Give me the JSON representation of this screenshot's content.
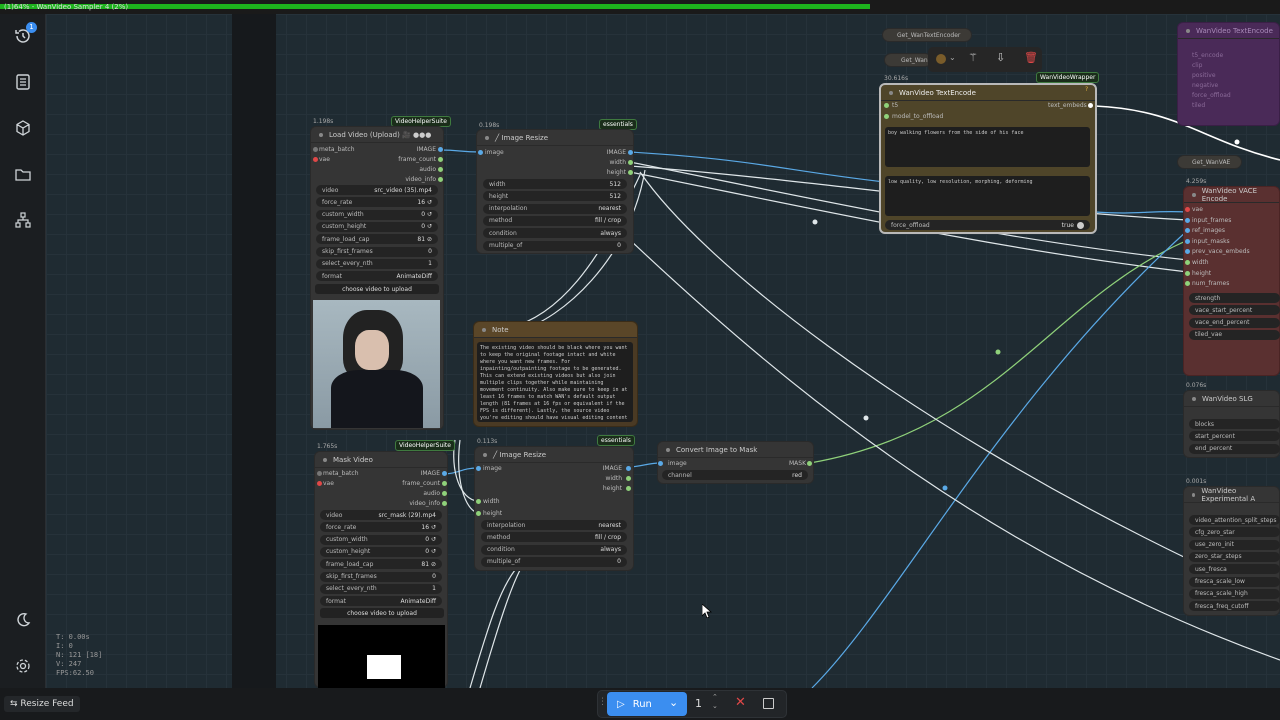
{
  "topbar": {
    "title": "(1)64% - WanVideo Sampler 4 (2%)",
    "progress_percent": 68
  },
  "sidebar": {
    "queue_badge": "1",
    "icons": [
      "history-icon",
      "document-icon",
      "cube-icon",
      "folder-icon",
      "workflow-icon",
      "moon-icon",
      "settings-icon"
    ]
  },
  "stats": {
    "t": "T: 0.00s",
    "i": "I: 0",
    "n": "N: 121 [18]",
    "v": "V: 247",
    "fps": "FPS:62.50"
  },
  "bottom": {
    "resize_feed": "⇆ Resize Feed",
    "run_label": "Run",
    "run_count": "1"
  },
  "load_video": {
    "timing": "1.198s",
    "badge": "VideoHelperSuite",
    "title": "Load Video (Upload) 🎥 ●●●",
    "inputs": [
      "meta_batch",
      "vae"
    ],
    "outputs": [
      "IMAGE",
      "frame_count",
      "audio",
      "video_info"
    ],
    "widgets": [
      {
        "label": "video",
        "value": "src_video (35).mp4"
      },
      {
        "label": "force_rate",
        "value": "16 ↺"
      },
      {
        "label": "custom_width",
        "value": "0 ↺"
      },
      {
        "label": "custom_height",
        "value": "0 ↺"
      },
      {
        "label": "frame_load_cap",
        "value": "81 ⊘"
      },
      {
        "label": "skip_first_frames",
        "value": "0"
      },
      {
        "label": "select_every_nth",
        "value": "1"
      },
      {
        "label": "format",
        "value": "AnimateDiff"
      }
    ],
    "upload_label": "choose video to upload"
  },
  "mask_video": {
    "timing": "1.765s",
    "badge": "VideoHelperSuite",
    "title": "Mask Video",
    "inputs": [
      "meta_batch",
      "vae"
    ],
    "outputs": [
      "IMAGE",
      "frame_count",
      "audio",
      "video_info"
    ],
    "widgets": [
      {
        "label": "video",
        "value": "src_mask (29).mp4"
      },
      {
        "label": "force_rate",
        "value": "16 ↺"
      },
      {
        "label": "custom_width",
        "value": "0 ↺"
      },
      {
        "label": "custom_height",
        "value": "0 ↺"
      },
      {
        "label": "frame_load_cap",
        "value": "81 ⊘"
      },
      {
        "label": "skip_first_frames",
        "value": "0"
      },
      {
        "label": "select_every_nth",
        "value": "1"
      },
      {
        "label": "format",
        "value": "AnimateDiff"
      }
    ],
    "upload_label": "choose video to upload"
  },
  "resize1": {
    "timing": "0.198s",
    "badge": "essentials",
    "title": "╱ Image Resize",
    "input": "image",
    "outputs": [
      "IMAGE",
      "width",
      "height"
    ],
    "widgets": [
      {
        "label": "width",
        "value": "512"
      },
      {
        "label": "height",
        "value": "512"
      },
      {
        "label": "interpolation",
        "value": "nearest"
      },
      {
        "label": "method",
        "value": "fill / crop"
      },
      {
        "label": "condition",
        "value": "always"
      },
      {
        "label": "multiple_of",
        "value": "0"
      }
    ]
  },
  "resize2": {
    "timing": "0.113s",
    "badge": "essentials",
    "title": "╱ Image Resize",
    "inputs": [
      "image",
      "width",
      "height"
    ],
    "outputs": [
      "IMAGE",
      "width",
      "height"
    ],
    "widgets": [
      {
        "label": "interpolation",
        "value": "nearest"
      },
      {
        "label": "method",
        "value": "fill / crop"
      },
      {
        "label": "condition",
        "value": "always"
      },
      {
        "label": "multiple_of",
        "value": "0"
      }
    ]
  },
  "note": {
    "title": "Note",
    "text": "The existing video should be black where you want to keep the original footage intact and white where you want new frames. For inpainting/outpainting footage to be generated. This can extend existing videos but also join multiple clips together while maintaining movement continuity. Also make sure to keep in at least 16 frames to match WAN's default output length (81 frames at 16 fps or equivalent if the FPS is different). Lastly, the source video you're editing should have visual editing content grayed out (frames to generate or areas you want filled/replaced) so WAN knows where you want video to write. You can download VACE's example clip here for the basic"
  },
  "convert_mask": {
    "title": "Convert Image to Mask",
    "input": "image",
    "output": "MASK",
    "widget": {
      "label": "channel",
      "value": "red"
    }
  },
  "get_text_encoder": {
    "label": "Get_WanTextEncoder"
  },
  "get_wan": {
    "label": "Get_Wan"
  },
  "get_vae": {
    "label": "Get_WanVAE"
  },
  "text_encode": {
    "timing": "30.616s",
    "badge": "WanVideoWrapper",
    "title": "WanVideo TextEncode",
    "help": "?",
    "inputs": [
      "t5",
      "model_to_offload"
    ],
    "output": "text_embeds",
    "positive": "boy walking flowers from the side of his face",
    "negative": "low quality, low resolution, morphing, deforming",
    "force_offload": {
      "label": "force_offload",
      "value": "true"
    }
  },
  "vace_encode": {
    "timing": "4.259s",
    "title": "WanVideo VACE Encode",
    "inputs": [
      "vae",
      "input_frames",
      "ref_images",
      "input_masks",
      "prev_vace_embeds",
      "width",
      "height",
      "num_frames"
    ],
    "widgets": [
      "strength",
      "vace_start_percent",
      "vace_end_percent",
      "tiled_vae"
    ]
  },
  "slg": {
    "timing": "0.076s",
    "title": "WanVideo SLG",
    "widgets": [
      "blocks",
      "start_percent",
      "end_percent"
    ]
  },
  "experimental": {
    "timing": "0.001s",
    "title": "WanVideo Experimental A",
    "widgets": [
      "video_attention_split_steps",
      "cfg_zero_star",
      "use_zero_init",
      "zero_star_steps",
      "use_fresca",
      "fresca_scale_low",
      "fresca_scale_high",
      "fresca_freq_cutoff"
    ]
  },
  "purple_node": {
    "title": "WanVideo TextEncode",
    "widgets": [
      "t5_encode",
      "clip",
      "positive",
      "negative",
      "force_offload",
      "tiled"
    ]
  },
  "colors": {
    "accent": "#3b8ef0",
    "progress": "#1db31d",
    "wire_blue": "#5aa9e6",
    "wire_green": "#8fd17a",
    "wire_white": "#dfe6e9",
    "note_bg": "#4a3a24",
    "text_encode_bg": "#4f4529",
    "vace_bg": "#5a3030",
    "purple": "#5a2d6a"
  }
}
